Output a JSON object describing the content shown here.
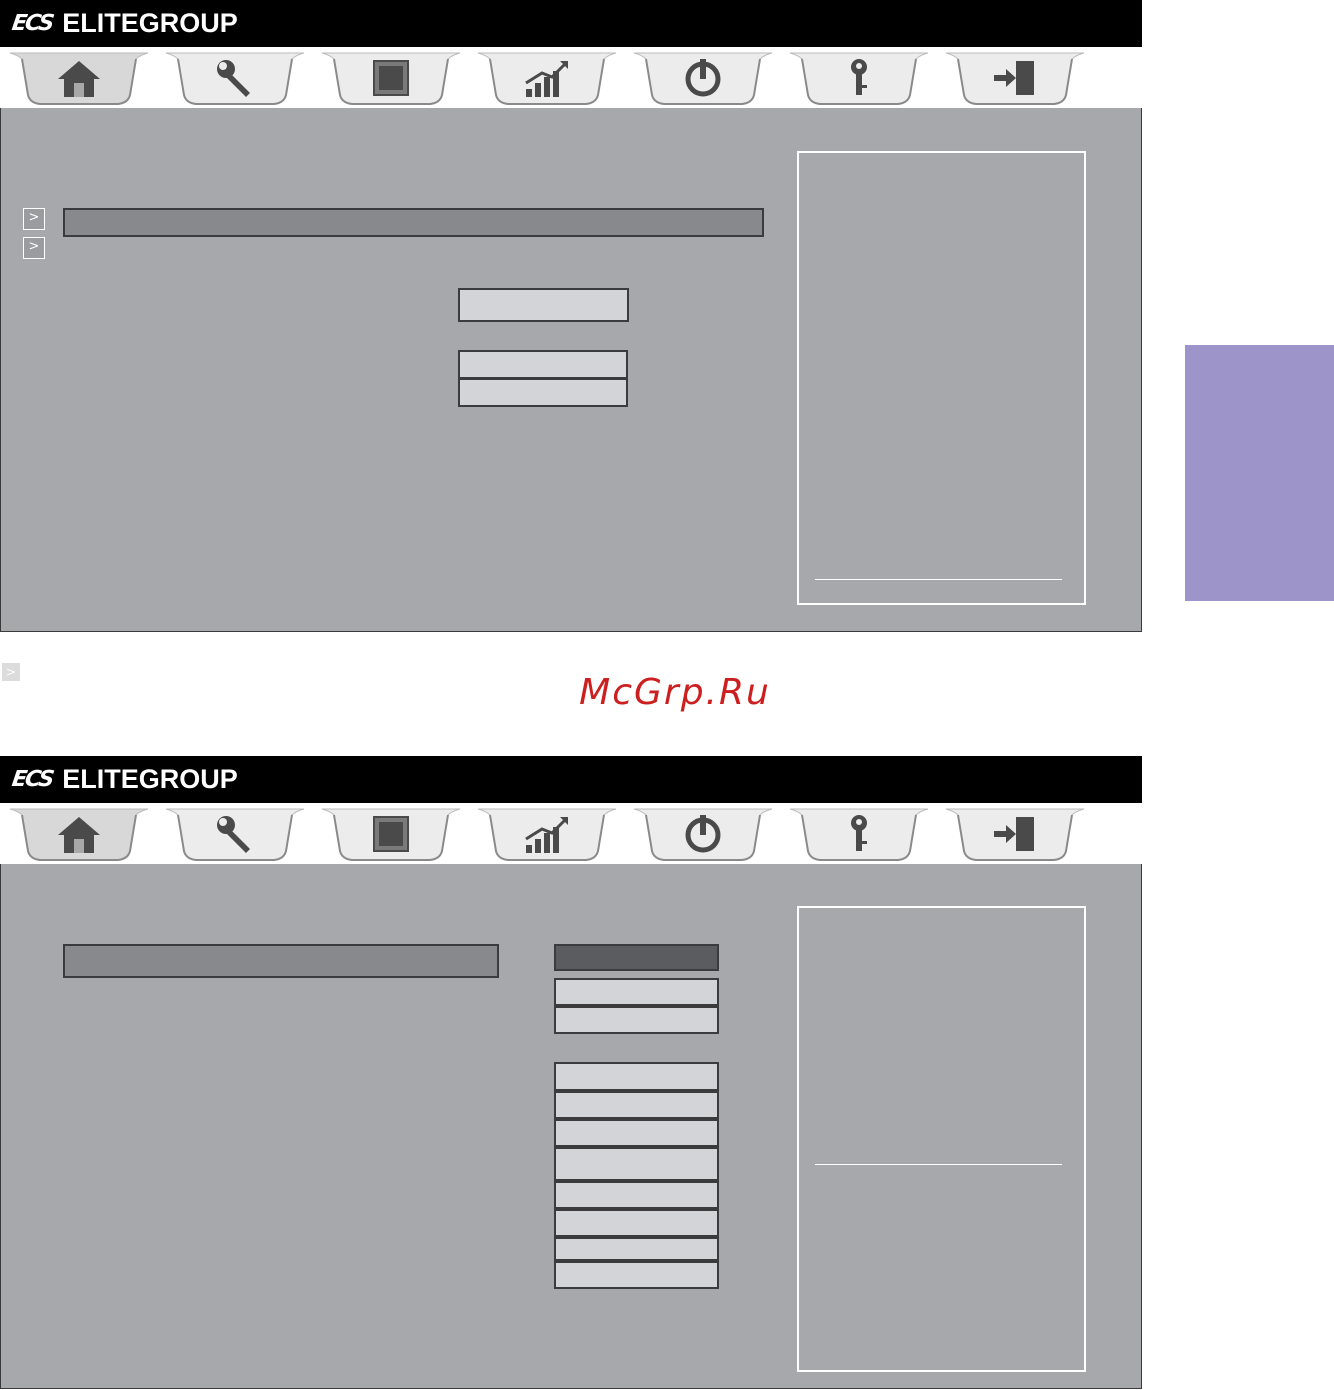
{
  "brand": {
    "mark": "ECS",
    "name": "ELITEGROUP"
  },
  "tabs": [
    {
      "icon": "home-icon"
    },
    {
      "icon": "wrench-icon"
    },
    {
      "icon": "chip-icon"
    },
    {
      "icon": "chart-growth-icon"
    },
    {
      "icon": "power-icon"
    },
    {
      "icon": "key-icon"
    },
    {
      "icon": "exit-door-icon"
    }
  ],
  "watermark": "McGrp.Ru",
  "colors": {
    "panel": "#a7a8ac",
    "titlebar": "#000000",
    "highlight_bar": "#88898d",
    "field": "#d3d4d7",
    "sidetab": "#9d95c9",
    "watermark": "#cc1f1f"
  },
  "glyphs": {
    "submenu_arrow": ">"
  }
}
